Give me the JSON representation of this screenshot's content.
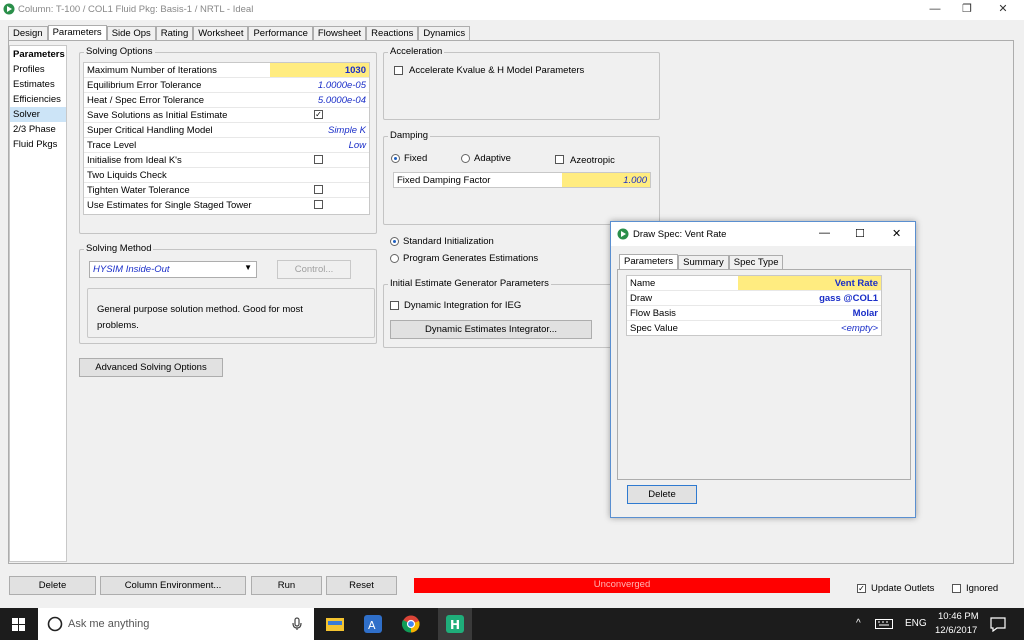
{
  "window": {
    "title": "Column: T-100 / COL1  Fluid Pkg: Basis-1 / NRTL - Ideal",
    "controls": {
      "minimize": "—",
      "restore": "❐",
      "close": "✕"
    }
  },
  "tabs": [
    "Design",
    "Parameters",
    "Side Ops",
    "Rating",
    "Worksheet",
    "Performance",
    "Flowsheet",
    "Reactions",
    "Dynamics"
  ],
  "left_nav": {
    "header": "Parameters",
    "items": [
      "Profiles",
      "Estimates",
      "Efficiencies",
      "Solver",
      "2/3 Phase",
      "Fluid Pkgs"
    ],
    "selected_index": 3
  },
  "solving_options": {
    "title": "Solving Options",
    "rows": [
      {
        "label": "Maximum Number of Iterations",
        "value": "1030"
      },
      {
        "label": "Equilibrium Error Tolerance",
        "value": "1.0000e-05"
      },
      {
        "label": "Heat / Spec Error Tolerance",
        "value": "5.0000e-04"
      },
      {
        "label": "Save Solutions as Initial Estimate",
        "value": ""
      },
      {
        "label": "Super Critical Handling Model",
        "value": "Simple K"
      },
      {
        "label": "Trace Level",
        "value": "Low"
      },
      {
        "label": "Initialise from Ideal K's",
        "value": ""
      },
      {
        "label": "Two Liquids Check",
        "value": ""
      },
      {
        "label": "Tighten Water Tolerance",
        "value": ""
      },
      {
        "label": "Use Estimates for Single Staged Tower",
        "value": ""
      }
    ]
  },
  "acceleration": {
    "title": "Acceleration",
    "checkbox_label": "Accelerate Kvalue & H Model Parameters"
  },
  "damping": {
    "title": "Damping",
    "radio_fixed": "Fixed",
    "radio_adaptive": "Adaptive",
    "checkbox_azeotropic": "Azeotropic",
    "factor_label": "Fixed Damping Factor",
    "factor_value": "1.000"
  },
  "initialization": {
    "standard": "Standard Initialization",
    "program": "Program Generates Estimations"
  },
  "ieg": {
    "title": "Initial Estimate Generator Parameters",
    "checkbox_label": "Dynamic Integration for IEG",
    "button": "Dynamic Estimates Integrator..."
  },
  "solving_method": {
    "title": "Solving Method",
    "selected": "HYSIM Inside-Out",
    "control_button": "Control...",
    "description": "General purpose solution method. Good for most problems."
  },
  "advanced_button": "Advanced Solving Options",
  "bottom": {
    "delete": "Delete",
    "column_env": "Column Environment...",
    "run": "Run",
    "reset": "Reset",
    "status": "Unconverged",
    "status_color": "#ff0000",
    "update_outlets": "Update Outlets",
    "ignored": "Ignored"
  },
  "dialog": {
    "title": "Draw Spec: Vent Rate",
    "tabs": [
      "Parameters",
      "Summary",
      "Spec Type"
    ],
    "rows": [
      {
        "label": "Name",
        "value": "Vent Rate"
      },
      {
        "label": "Draw",
        "value": "gass @COL1"
      },
      {
        "label": "Flow Basis",
        "value": "Molar"
      },
      {
        "label": "Spec Value",
        "value": "<empty>"
      }
    ],
    "delete_button": "Delete"
  },
  "taskbar": {
    "search_placeholder": "Ask me anything",
    "language": "ENG",
    "time": "10:46 PM",
    "date": "12/6/2017"
  },
  "colors": {
    "accent": "#ffec80",
    "value_blue": "#1a2ec8",
    "taskbar": "#1c1c1c"
  }
}
